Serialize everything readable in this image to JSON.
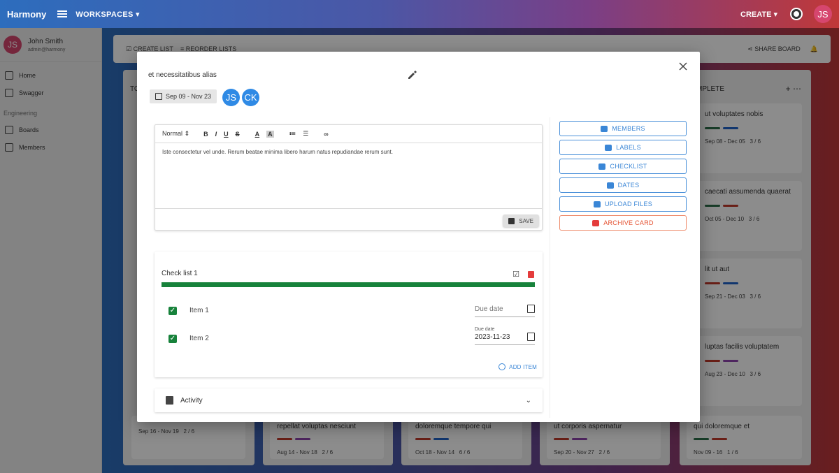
{
  "topbar": {
    "brand": "Harmony",
    "workspaces": "WORKSPACES",
    "create": "CREATE",
    "avatar": "JS"
  },
  "sidebar": {
    "user_initials": "JS",
    "user_name": "John Smith",
    "user_email": "admin@harmony",
    "items": [
      {
        "label": "Home"
      },
      {
        "label": "Swagger"
      }
    ],
    "section": "Engineering",
    "section_items": [
      {
        "label": "Boards"
      },
      {
        "label": "Members"
      }
    ]
  },
  "board": {
    "toolbar": {
      "create_list": "CREATE LIST",
      "reorder_lists": "REORDER LISTS",
      "share_board": "SHARE BOARD"
    },
    "column_titles": [
      "TO",
      "MPLETE"
    ],
    "right_cards": [
      {
        "title": "ut voluptates nobis",
        "dates": "Sep 08 - Dec 05",
        "checks": "3 / 6"
      },
      {
        "title": "caecati assumenda quaerat",
        "dates": "Oct 05 - Dec 10",
        "checks": "3 / 6"
      },
      {
        "title": "lit ut aut",
        "dates": "Sep 21 - Dec 03",
        "checks": "3 / 6"
      },
      {
        "title": "luptas facilis voluptatem",
        "dates": "Aug 23 - Dec 10",
        "checks": "3 / 6"
      }
    ],
    "bottom_cards": [
      {
        "title": "",
        "dates": "Sep 16 - Nov 19",
        "checks": "2 / 6"
      },
      {
        "title": "repellat voluptas nesciunt",
        "dates": "Aug 14 - Nov 18",
        "checks": "2 / 6"
      },
      {
        "title": "doloremque tempore qui",
        "dates": "Oct 18 - Nov 14",
        "checks": "6 / 6"
      },
      {
        "title": "ut corporis aspernatur",
        "dates": "Sep 20 - Nov 27",
        "checks": "2 / 6"
      },
      {
        "title": "qui doloremque et",
        "dates": "Nov 09 - 16",
        "checks": "1 / 6"
      }
    ]
  },
  "modal": {
    "title": "et necessitatibus alias",
    "date_range": "Sep 09 - Nov 23",
    "members": [
      "JS",
      "CK"
    ],
    "editor": {
      "format": "Normal",
      "text": "Iste consectetur vel unde. Rerum beatae minima libero harum natus repudiandae rerum sunt.",
      "save": "SAVE"
    },
    "checklist": {
      "title": "Check list 1",
      "progress": 1.0,
      "items": [
        {
          "label": "Item 1",
          "due_placeholder": "Due date",
          "due_label": "",
          "due_value": ""
        },
        {
          "label": "Item 2",
          "due_placeholder": "",
          "due_label": "Due date",
          "due_value": "2023-11-23"
        }
      ],
      "add_item": "ADD ITEM"
    },
    "activity": "Activity",
    "actions": [
      "MEMBERS",
      "LABELS",
      "CHECKLIST",
      "DATES",
      "UPLOAD FILES"
    ],
    "archive": "ARCHIVE CARD"
  }
}
